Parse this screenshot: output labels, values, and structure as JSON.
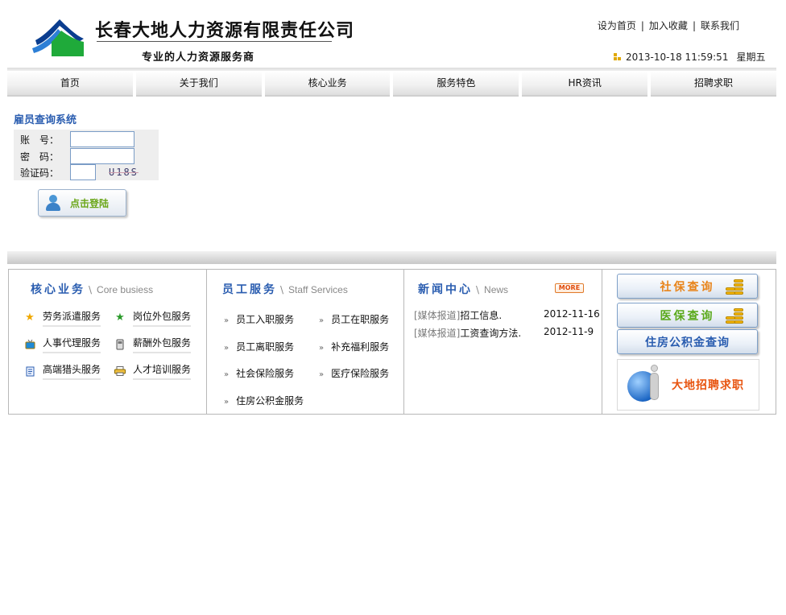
{
  "header": {
    "company_name": "长春大地人力资源有限责任公司",
    "slogan": "专业的人力资源服务商",
    "top_links": [
      "设为首页",
      "加入收藏",
      "联系我们"
    ],
    "date": "2013-10-18 11:59:51",
    "weekday": "星期五"
  },
  "nav": {
    "items": [
      "首页",
      "关于我们",
      "核心业务",
      "服务特色",
      "HR资讯",
      "招聘求职"
    ]
  },
  "login": {
    "title": "雇员查询系统",
    "account_label": "账　号：",
    "password_label": "密　码：",
    "captcha_label": "验证码：",
    "captcha_text": "U18S",
    "button_label": "点击登陆"
  },
  "core": {
    "title_cn": "核心业务",
    "title_en": "Core busiess",
    "items": [
      "劳务派遣服务",
      "岗位外包服务",
      "人事代理服务",
      "薪酬外包服务",
      "高端猎头服务",
      "人才培训服务"
    ],
    "icons": [
      "star-icon",
      "green-star-icon",
      "tv-icon",
      "phone-icon",
      "document-icon",
      "printer-icon"
    ]
  },
  "staff": {
    "title_cn": "员工服务",
    "title_en": "Staff Services",
    "items": [
      "员工入职服务",
      "员工在职服务",
      "员工离职服务",
      "补充福利服务",
      "社会保险服务",
      "医疗保险服务",
      "住房公积金服务"
    ]
  },
  "news": {
    "title_cn": "新闻中心",
    "title_en": "News",
    "more_label": "MORE",
    "items": [
      {
        "tag": "[媒体报道]",
        "title": "招工信息.",
        "date": "2012-11-16"
      },
      {
        "tag": "[媒体报道]",
        "title": "工资查询方法.",
        "date": "2012-11-9"
      }
    ]
  },
  "quick_links": {
    "social_security": "社保查询",
    "medical_insurance": "医保查询",
    "housing_fund": "住房公积金查询",
    "recruit": "大地招聘求职",
    "colors": {
      "social_security": "#e8841a",
      "medical_insurance": "#5aa91b",
      "housing_fund": "#2a5db0"
    }
  },
  "colors": {
    "accent_blue": "#2a5db0",
    "login_green": "#6aa618",
    "recruit_orange": "#e8540f"
  }
}
